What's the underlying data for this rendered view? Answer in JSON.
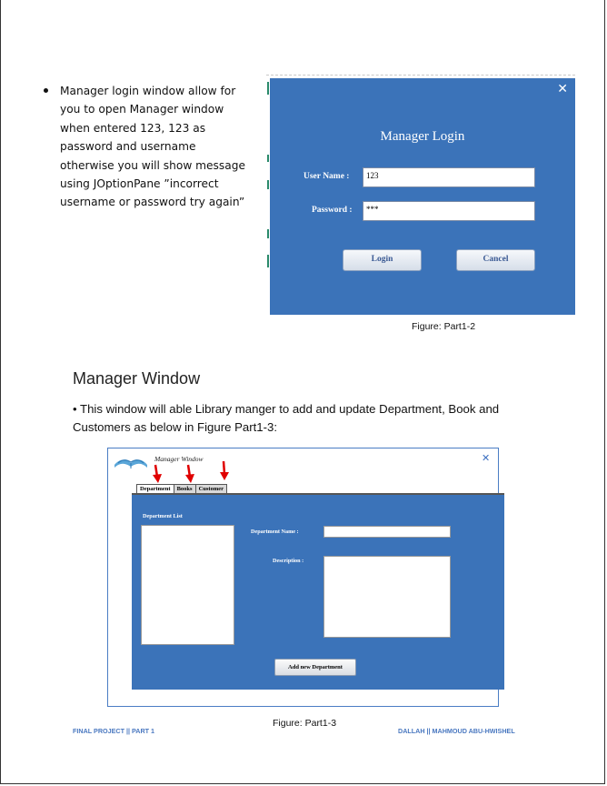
{
  "bullet": {
    "text": "Manager login window allow for you to open Manager window when entered 123, 123 as password and username otherwise you will show message using JOptionPane ”incorrect username or password try again”"
  },
  "login_window": {
    "title": "Manager Login",
    "close_symbol": "✕",
    "username_label": "User Name :",
    "username_value": "123",
    "password_label": "Password :",
    "password_value": "***",
    "login_button": "Login",
    "cancel_button": "Cancel",
    "caption": "Figure: Part1-2",
    "background_color": "#3b73b9"
  },
  "section": {
    "heading": "Manager Window",
    "bullet_text": "• This window will able Library manger to add and update Department, Book and Customers as below in Figure Part1-3:"
  },
  "manager_window": {
    "title": "Manager Window",
    "close_symbol": "✕",
    "logo_icon": "open-book-icon",
    "tabs": [
      "Department",
      "Books",
      "Customer"
    ],
    "department_list_label": "Department List",
    "department_name_label": "Department Name :",
    "description_label": "Description :",
    "add_button": "Add new Department",
    "caption": "Figure: Part1-3",
    "arrow_color": "#e00000"
  },
  "footer": {
    "left": "FINAL PROJECT || PART 1",
    "right": "DALLAH || MAHMOUD ABU-HWISHEL"
  }
}
